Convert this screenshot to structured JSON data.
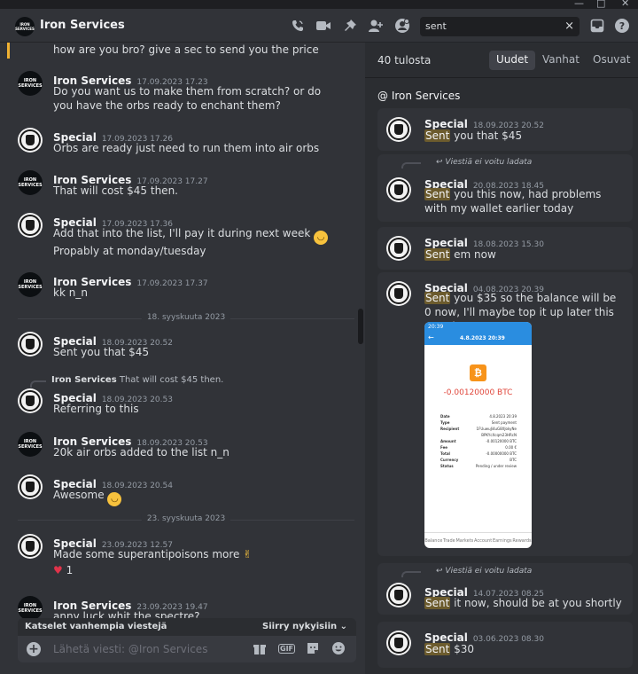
{
  "window": {
    "minimize": "—",
    "maximize": "□",
    "close": "✕"
  },
  "header": {
    "title": "Iron Services",
    "avatar_text": "IRON SERVICES",
    "search_value": "sent",
    "search_clear": "×"
  },
  "messages": [
    {
      "text": "how are you bro? give a sec to send you the price"
    },
    {
      "user": "Iron Services",
      "time": "17.09.2023 17.23",
      "text": "Do you want us to make them from scratch? or do you have the orbs ready to enchant them?"
    },
    {
      "user": "Special",
      "time": "17.09.2023 17.26",
      "text": "Orbs are ready just need to run them into air orbs"
    },
    {
      "user": "Iron Services",
      "time": "17.09.2023 17.27",
      "text": "That will cost $45 then."
    },
    {
      "user": "Special",
      "time": "17.09.2023 17.36",
      "text": "Add that into the list, I'll pay it during next week",
      "text2": "Propably at monday/tuesday"
    },
    {
      "user": "Iron Services",
      "time": "17.09.2023 17.37",
      "text": "kk n_n"
    },
    {
      "user": "Special",
      "time": "18.09.2023 20.52",
      "text": "Sent you that $45"
    },
    {
      "user": "Special",
      "time": "18.09.2023 20.53",
      "text": "Referring to this",
      "reply_user": "Iron Services",
      "reply_text": "That will cost $45 then."
    },
    {
      "user": "Iron Services",
      "time": "18.09.2023 20.53",
      "text": "20k air orbs added to the list n_n"
    },
    {
      "user": "Special",
      "time": "18.09.2023 20.54",
      "text": "Awesome"
    },
    {
      "user": "Special",
      "time": "23.09.2023 12.57",
      "text": "Made some superantipoisons more",
      "reaction_count": "1"
    },
    {
      "user": "Iron Services",
      "time": "23.09.2023 19.47",
      "text": "anny luck whit the spectre?"
    }
  ],
  "dividers": [
    "18. syyskuuta 2023",
    "23. syyskuuta 2023"
  ],
  "jumpbar": {
    "left": "Katselet vanhempia viestejä",
    "right": "Siirry nykyisiin"
  },
  "composer": {
    "placeholder": "Lähetä viesti: @Iron Services",
    "gif": "GIF"
  },
  "results": {
    "count": "40 tulosta",
    "tabs": [
      "Uudet",
      "Vanhat",
      "Osuvat"
    ],
    "channel": "@ Iron Services",
    "notice": "Viestiä ei voitu ladata",
    "highlight": "Sent",
    "items": [
      {
        "user": "Special",
        "time": "18.09.2023 20.52",
        "rest": " you that $45"
      },
      {
        "user": "Special",
        "time": "20.08.2023 18.45",
        "rest": " you this now, had problems with my wallet earlier today"
      },
      {
        "user": "Special",
        "time": "18.08.2023 15.30",
        "rest": " em now"
      },
      {
        "user": "Special",
        "time": "04.08.2023 20.39",
        "rest": " you $35 so the balance will be 0 now, I'll maybe top it up later this month"
      },
      {
        "user": "Special",
        "time": "14.07.2023 08.25",
        "rest": " it now, should be at you shortly"
      },
      {
        "user": "Special",
        "time": "03.06.2023 08.30",
        "rest": " $30"
      }
    ]
  },
  "phone": {
    "status_time": "20:39",
    "title": "4.8.2023 20:39",
    "amount": "-0.00120000 BTC",
    "rows": [
      [
        "Date",
        "4.8.2023 20:39"
      ],
      [
        "Type",
        "Sent payment"
      ],
      [
        "Recipient",
        "1FUuwuJi4uG8XJokyNe"
      ],
      [
        "",
        "BPKYcXcqm23HRcN"
      ],
      [
        "Amount",
        "-0.00120000 BTC"
      ],
      [
        "Fee",
        "0.00 €"
      ],
      [
        "Total",
        "-0.00000000 BTC"
      ],
      [
        "Currency",
        "BTC"
      ],
      [
        "Status",
        "Pending / under review"
      ]
    ],
    "nav": [
      "Balance",
      "Trade",
      "Markets",
      "Account",
      "Earnings",
      "Rewards"
    ]
  }
}
